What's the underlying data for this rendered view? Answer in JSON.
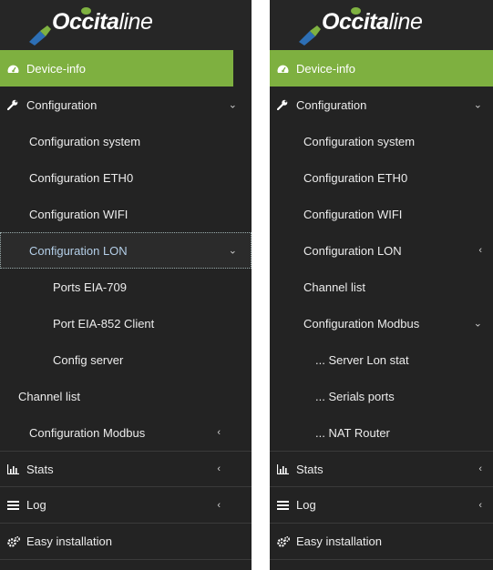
{
  "logo": {
    "brand_bold": "Occita",
    "brand_light": "line"
  },
  "left_menu": {
    "device_info": "Device-info",
    "configuration": "Configuration",
    "config_system": "Configuration system",
    "config_eth0": "Configuration ETH0",
    "config_wifi": "Configuration WIFI",
    "config_lon": "Configuration LON",
    "ports_eia709": "Ports EIA-709",
    "port_eia852": "Port EIA-852 Client",
    "config_server": "Config server",
    "channel_list": "Channel list",
    "config_modbus": "Configuration Modbus",
    "stats": "Stats",
    "log": "Log",
    "easy_install": "Easy installation"
  },
  "right_menu": {
    "device_info": "Device-info",
    "configuration": "Configuration",
    "config_system": "Configuration system",
    "config_eth0": "Configuration ETH0",
    "config_wifi": "Configuration WIFI",
    "config_lon": "Configuration LON",
    "channel_list": "Channel list",
    "config_modbus": "Configuration Modbus",
    "server_lon_stat": "... Server Lon stat",
    "serials_ports": "... Serials ports",
    "nat_router": "... NAT Router",
    "stats": "Stats",
    "log": "Log",
    "easy_install": "Easy installation"
  },
  "icons": {
    "dashboard": "dashboard-icon",
    "wrench": "wrench-icon",
    "chart": "bar-chart-icon",
    "list": "list-icon",
    "cogs": "cogs-icon",
    "chevron_down": "chevron-down-icon",
    "chevron_left": "chevron-left-icon"
  },
  "colors": {
    "active": "#7eb040",
    "sidebar": "#232323",
    "selected_text": "#b4cfe8"
  }
}
